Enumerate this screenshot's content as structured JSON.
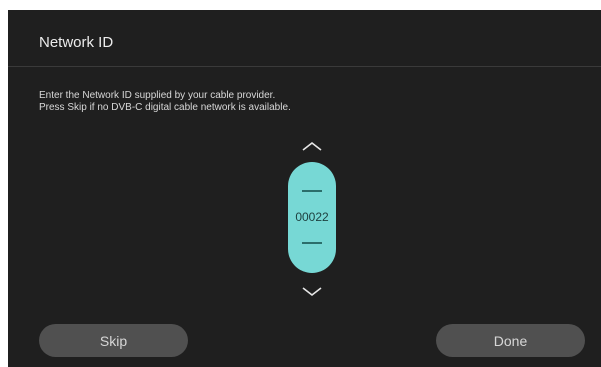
{
  "dialog": {
    "title": "Network ID",
    "instruction_line1": "Enter the Network ID supplied by your cable provider.",
    "instruction_line2": "Press Skip if no DVB-C digital cable network is available."
  },
  "picker": {
    "value": "00022",
    "up_icon": "chevron-up-icon",
    "down_icon": "chevron-down-icon",
    "color": "#77d8d5"
  },
  "buttons": {
    "skip_label": "Skip",
    "done_label": "Done"
  },
  "colors": {
    "background": "#1f1f1f",
    "button": "#505050",
    "accent": "#77d8d5"
  }
}
